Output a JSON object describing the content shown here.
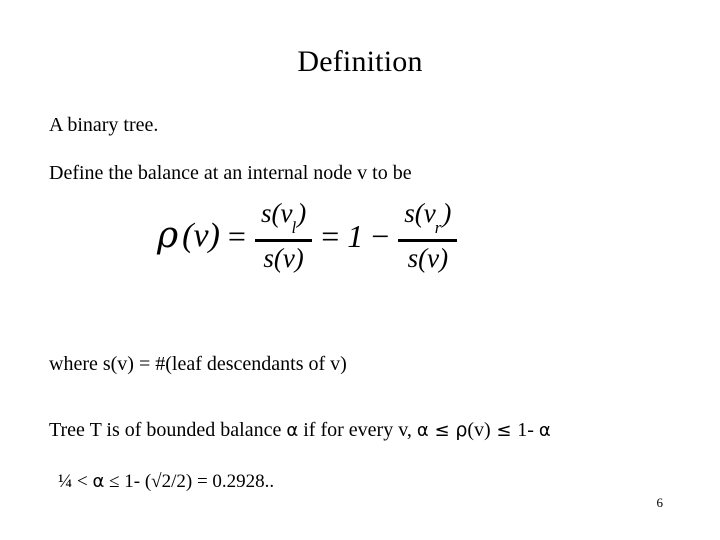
{
  "slide": {
    "title": "Definition",
    "page_number": "6",
    "background_color": "#ffffff",
    "text_color": "#000000"
  },
  "body": {
    "line_binary": "A binary tree.",
    "line_define": "Define the balance at an internal node v to be",
    "line_where": "where s(v) = #(leaf descendants of v)",
    "line_bounded_prefix": "Tree T is of bounded balance ",
    "line_bounded_alpha1": "α",
    "line_bounded_middle": " if for every v,  ",
    "line_bounded_alpha2": "α",
    "line_bounded_le1": " ≤ ",
    "line_bounded_rho": "ρ",
    "line_bounded_rho_arg": "(v)",
    "line_bounded_le2": " ≤ ",
    "line_bounded_suffix": " 1- ",
    "line_bounded_alpha3": "α",
    "line_range_prefix": "¼ < ",
    "line_range_alpha": "α",
    "line_range_suffix": " ≤ 1- (√2/2) = 0.2928.."
  },
  "equation": {
    "lhs_rho": "ρ",
    "lhs_arg": "(v)",
    "eq1": "=",
    "frac1_numerator": "s(v",
    "frac1_numerator_sub": "l",
    "frac1_numerator_close": ")",
    "frac1_denominator": "s(v)",
    "eq2": "=",
    "one": "1",
    "minus": "−",
    "frac2_numerator": "s(v",
    "frac2_numerator_sub": "r",
    "frac2_numerator_close": ")",
    "frac2_denominator": "s(v)"
  }
}
